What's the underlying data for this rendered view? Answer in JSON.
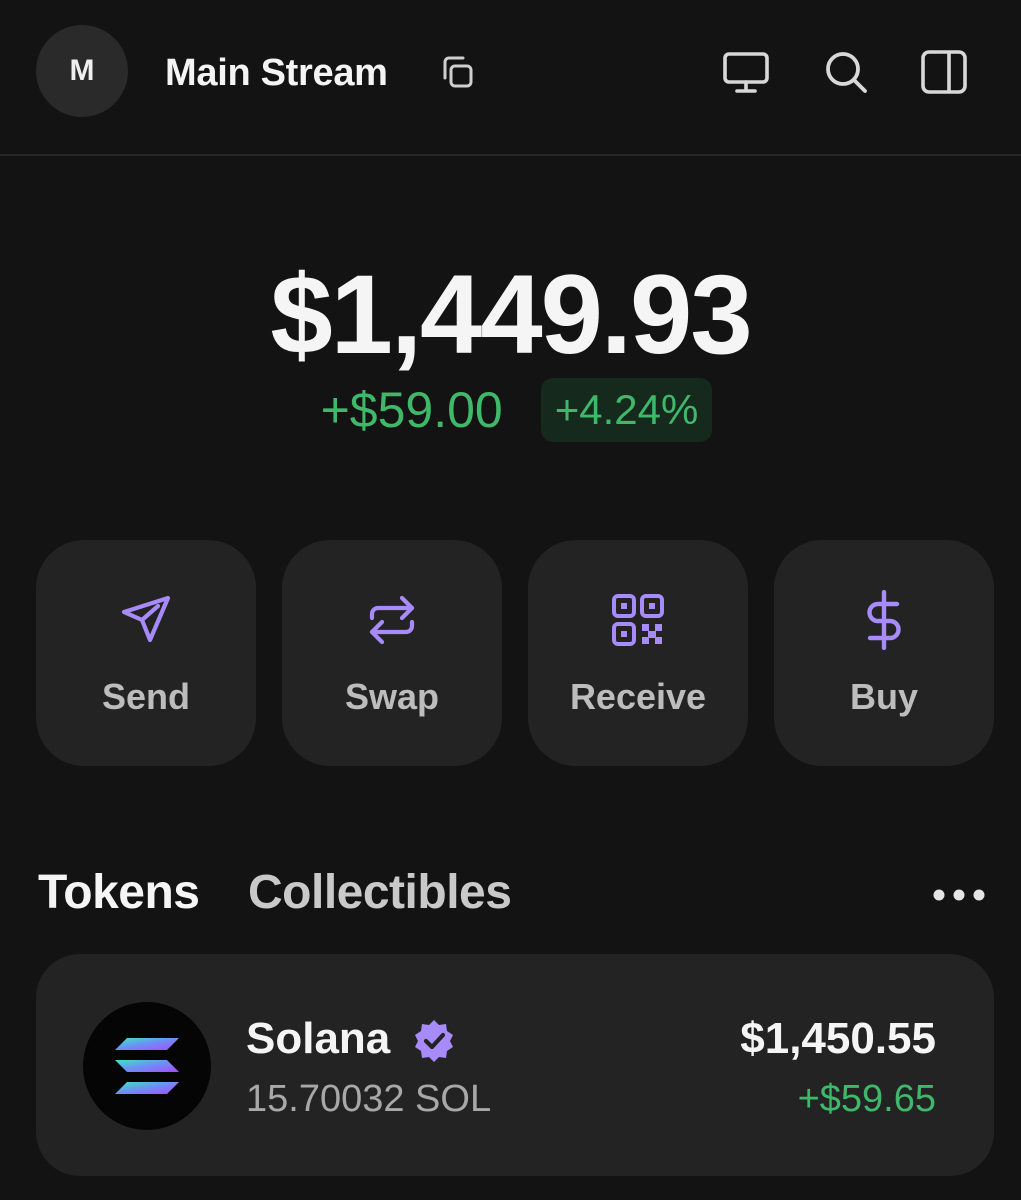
{
  "header": {
    "avatar_initial": "M",
    "account_name": "Main Stream",
    "icons": [
      "copy-icon",
      "monitor-icon",
      "search-icon",
      "sidebar-panel-icon"
    ]
  },
  "balance": {
    "total": "$1,449.93",
    "change_amount": "+$59.00",
    "change_percent": "+4.24%"
  },
  "actions": [
    {
      "label": "Send",
      "icon": "send-icon"
    },
    {
      "label": "Swap",
      "icon": "swap-icon"
    },
    {
      "label": "Receive",
      "icon": "qr-code-icon"
    },
    {
      "label": "Buy",
      "icon": "dollar-icon"
    }
  ],
  "tabs": {
    "tokens": "Tokens",
    "collectibles": "Collectibles",
    "active": "Tokens"
  },
  "tokens": [
    {
      "name": "Solana",
      "amount": "15.70032 SOL",
      "value": "$1,450.55",
      "change": "+$59.65",
      "verified": true
    }
  ],
  "colors": {
    "background": "#131313",
    "card": "#232323",
    "accent": "#a78bfa",
    "positive": "#3fb86a",
    "positive_bg": "#16291d"
  }
}
